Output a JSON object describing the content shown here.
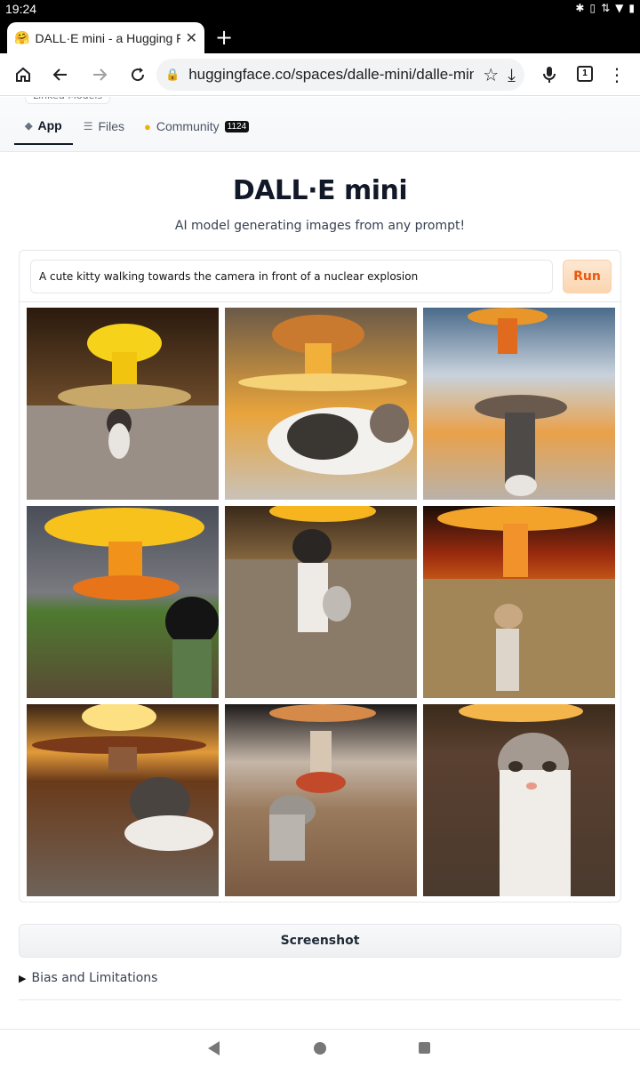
{
  "status_bar": {
    "time": "19:24",
    "icons": [
      "bluetooth-icon",
      "vibrate-icon",
      "data-icon",
      "wifi-icon",
      "battery-icon"
    ]
  },
  "browser": {
    "tab_title": "DALL·E mini - a Hugging Face",
    "tab_favicon": "hugging-face-emoji",
    "url": "huggingface.co/spaces/dalle-mini/dalle-mini",
    "tab_count": "1"
  },
  "space": {
    "linked_models": "Linked Models",
    "tabs": [
      {
        "label": "App",
        "icon": "cube-icon",
        "active": true
      },
      {
        "label": "Files",
        "icon": "files-icon",
        "active": false
      },
      {
        "label": "Community",
        "icon": "community-icon",
        "badge": "1124",
        "active": false
      }
    ]
  },
  "app": {
    "title": "DALL·E mini",
    "subtitle": "AI model generating images from any prompt!",
    "prompt": "A cute kitty walking towards the camera in front of a nuclear explosion",
    "run_label": "Run",
    "images_count": 9,
    "screenshot_label": "Screenshot",
    "bias_label": "Bias and Limitations"
  },
  "colors": {
    "accent": "#ea580c",
    "run_bg": "#fde8d4"
  }
}
